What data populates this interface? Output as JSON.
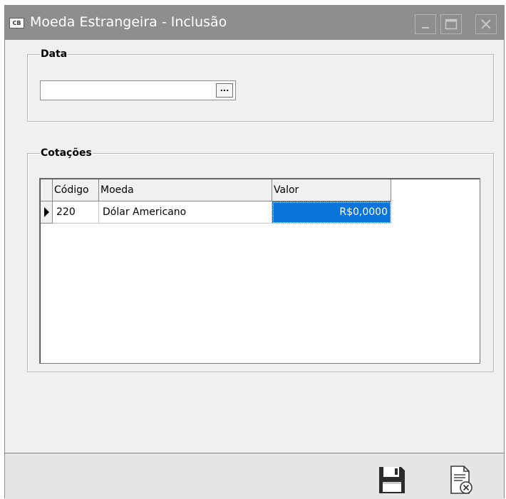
{
  "window": {
    "title": "Moeda Estrangeira - Inclusão",
    "app_icon_label": "CB"
  },
  "data_group": {
    "label": "Data",
    "date_value": "",
    "date_button_label": "..."
  },
  "cotacoes_group": {
    "label": "Cotações",
    "grid": {
      "columns": [
        "Código",
        "Moeda",
        "Valor"
      ],
      "rows": [
        {
          "codigo": "220",
          "moeda": "Dólar Americano",
          "valor": "R$0,0000"
        }
      ]
    }
  },
  "toolbar": {
    "save_icon": "floppy-disk-icon",
    "cancel_icon": "document-cancel-icon"
  },
  "colors": {
    "titlebar": "#8e8e8e",
    "selection": "#0a74d8",
    "window_bg": "#f0f0f0"
  }
}
